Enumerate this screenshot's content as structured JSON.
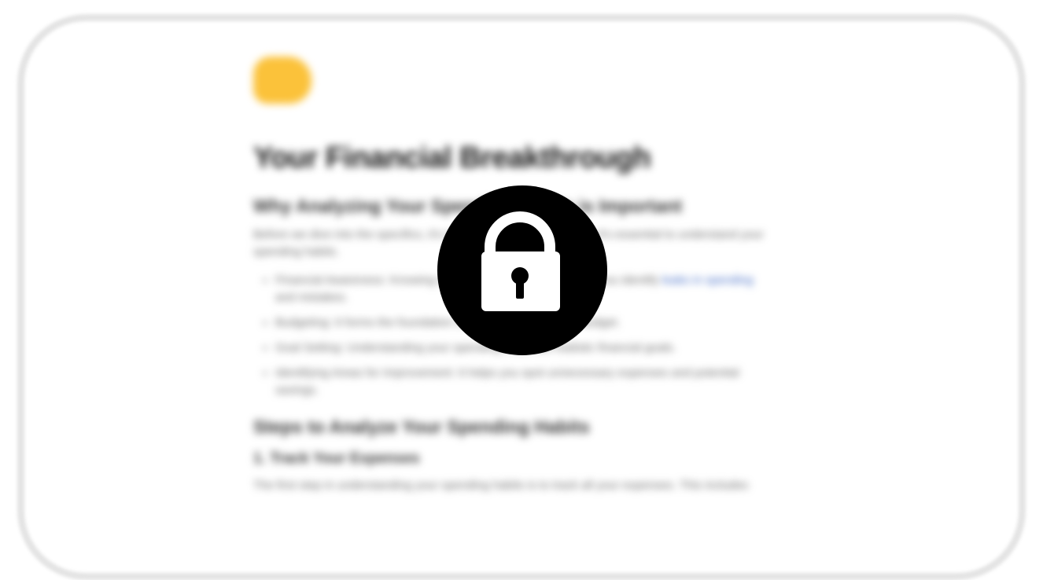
{
  "document": {
    "title": "Your Financial Breakthrough",
    "section1_heading": "Why Analyzing Your Spending Habits is Important",
    "section1_intro": "Before we dive into the specifics, it's important to understand why it's essential to understand your spending habits.",
    "bullets": [
      {
        "text": "Financial Awareness: Knowing where your money goes helps you identify ",
        "link": "leaks in spending",
        "tail": " and mistakes."
      },
      {
        "text": "Budgeting: It forms the foundation of an effective personal budget.",
        "link": "",
        "tail": ""
      },
      {
        "text": "Goal Setting: Understanding your spending helps set realistic financial goals.",
        "link": "",
        "tail": ""
      },
      {
        "text": "Identifying Areas for Improvement: It helps you spot unnecessary expenses and potential savings.",
        "link": "",
        "tail": ""
      }
    ],
    "section2_heading": "Steps to Analyze Your Spending Habits",
    "step1_heading": "1. Track Your Expenses",
    "step1_text": "The first step in understanding your spending habits is to track all your expenses. This includes"
  },
  "overlay": {
    "icon": "lock-icon",
    "background": "#000000",
    "icon_color": "#ffffff"
  },
  "colors": {
    "logo": "#fbc23a",
    "link": "#3b66c4",
    "frame_border": "#e4e4e4"
  }
}
